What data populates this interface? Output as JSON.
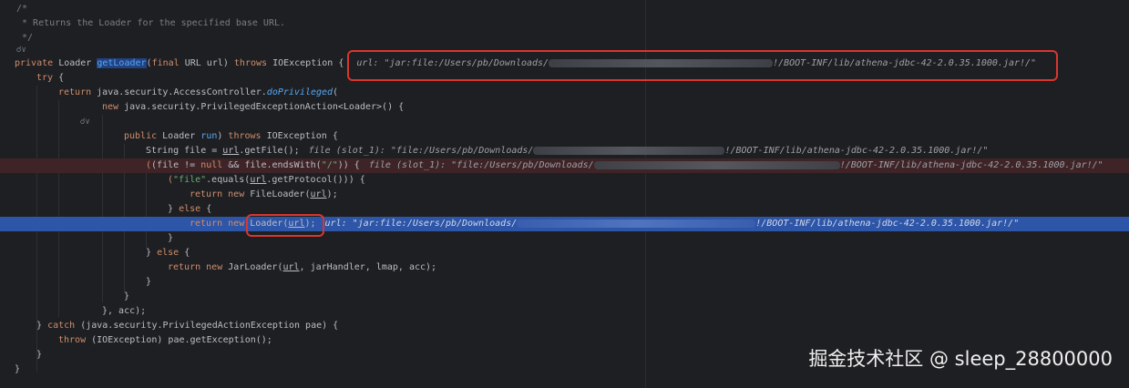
{
  "comment": {
    "open": "/*",
    "text": " * Returns the Loader for the specified base URL.",
    "close": " */"
  },
  "fold_marker": "☌∨",
  "code": {
    "private": "private",
    "Loader": "Loader",
    "getLoader": "getLoader",
    "final": "final",
    "URL": "URL",
    "url": "url",
    "throws": "throws",
    "IOException": "IOException",
    "try": "try",
    "return": "return",
    "java_security_AccessController": "java.security.AccessController.",
    "doPrivileged": "doPrivileged",
    "new": "new",
    "PrivilegedExceptionAction": "java.security.PrivilegedExceptionAction<Loader>() {",
    "public": "public",
    "run": "run",
    "String_file": "String file = ",
    "getFile": ".getFile();",
    "if_file": "(file != ",
    "null": "null",
    "and_file": " && file.endsWith(",
    "slash": "\"/\"",
    "if_close": ")) {",
    "if_open": "(",
    "file_str": "\"file\"",
    "equals": ".equals(",
    "getProtocol": ".getProtocol())) {",
    "FileLoader": "FileLoader(",
    "close_semi": ");",
    "else": "else",
    "Loader_url": "Loader(",
    "JarLoader": "JarLoader(",
    "jarHandler_rest": ", jarHandler, lmap, acc);",
    "acc_close": "}, acc);",
    "catch_line": "(java.security.PrivilegedActionException pae) {",
    "catch": "catch",
    "throw": "throw",
    "throw_rest": "(IOException) pae.getException();",
    "brace_open": "{",
    "brace_close": "}",
    "paren_close_url": "url) ",
    "paren_close": ") ",
    "open_paren": "("
  },
  "hints": {
    "url_prefix": "url: \"jar:file:/Users/pb/Downloads/",
    "url_suffix": "!/BOOT-INF/lib/athena-jdbc-42-2.0.35.1000.jar!/\"",
    "file_prefix": "file (slot_1): \"file:/Users/pb/Downloads/",
    "file_suffix": "!/BOOT-INF/lib/athena-jdbc-42-2.0.35.1000.jar!/\"",
    "file_suffix2": "!/BOOT-INF/lib/athena-jdbc-42-2.0.35.1000.jar!/\""
  },
  "watermark": "掘金技术社区 @ sleep_28800000",
  "colors": {
    "background": "#1e1f22",
    "keyword": "#cf8e6d",
    "method": "#56a8f5",
    "string": "#6aab73",
    "comment": "#7a7e85",
    "highlight_line": "#2d55a8",
    "breakpoint_line": "#3e2427",
    "callout": "#d7372f"
  }
}
